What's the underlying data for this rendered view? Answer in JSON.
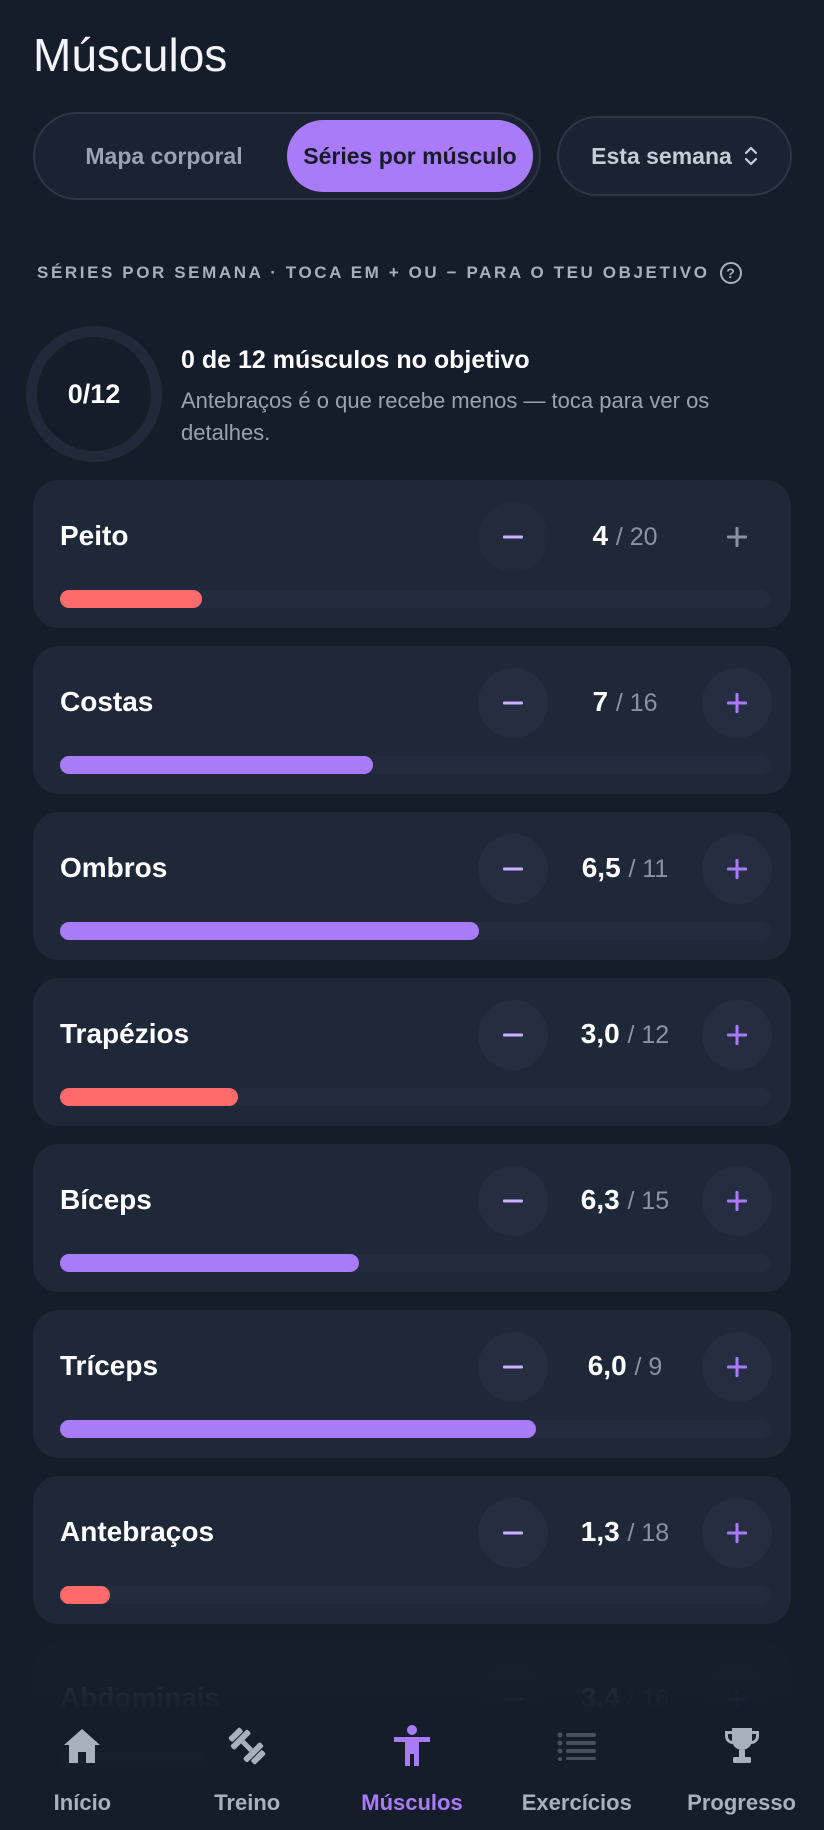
{
  "header": {
    "title": "Músculos"
  },
  "view_toggle": {
    "options": [
      "Mapa corporal",
      "Séries por músculo"
    ],
    "active_index": 1
  },
  "period_select": {
    "value": "Esta semana"
  },
  "section": {
    "label": "SÉRIES POR SEMANA · TOCA EM + OU − PARA O TEU OBJETIVO",
    "help_icon": "?"
  },
  "summary": {
    "ring_label": "0/12",
    "headline": "0 de 12 músculos no objetivo",
    "subtext": "Antebraços é o que recebe menos — toca para ver os detalhes."
  },
  "muscles": [
    {
      "name": "Peito",
      "sets": "4",
      "goal": "/ 20",
      "progress": 0.2,
      "status": "below"
    },
    {
      "name": "Costas",
      "sets": "7",
      "goal": "/ 16",
      "progress": 0.44,
      "status": "ok"
    },
    {
      "name": "Ombros",
      "sets": "6,5",
      "goal": "/ 11",
      "progress": 0.59,
      "status": "ok"
    },
    {
      "name": "Trapézios",
      "sets": "3,0",
      "goal": "/ 12",
      "progress": 0.25,
      "status": "below"
    },
    {
      "name": "Bíceps",
      "sets": "6,3",
      "goal": "/ 15",
      "progress": 0.42,
      "status": "ok"
    },
    {
      "name": "Tríceps",
      "sets": "6,0",
      "goal": "/ 9",
      "progress": 0.67,
      "status": "ok"
    },
    {
      "name": "Antebraços",
      "sets": "1,3",
      "goal": "/ 18",
      "progress": 0.07,
      "status": "below"
    },
    {
      "name": "Abdominais",
      "sets": "3,4",
      "goal": "/ 16",
      "progress": 0.21,
      "status": "below"
    }
  ],
  "colors": {
    "accent": "#a97bf8",
    "below_goal": "#ff6b6b",
    "background": "#161d2a",
    "card": "#1f2839"
  },
  "bottom_nav": {
    "items": [
      {
        "label": "Início",
        "icon": "home-icon"
      },
      {
        "label": "Treino",
        "icon": "dumbbell-icon"
      },
      {
        "label": "Músculos",
        "icon": "body-icon"
      },
      {
        "label": "Exercícios",
        "icon": "list-icon"
      },
      {
        "label": "Progresso",
        "icon": "trophy-icon"
      }
    ],
    "active_index": 2
  }
}
